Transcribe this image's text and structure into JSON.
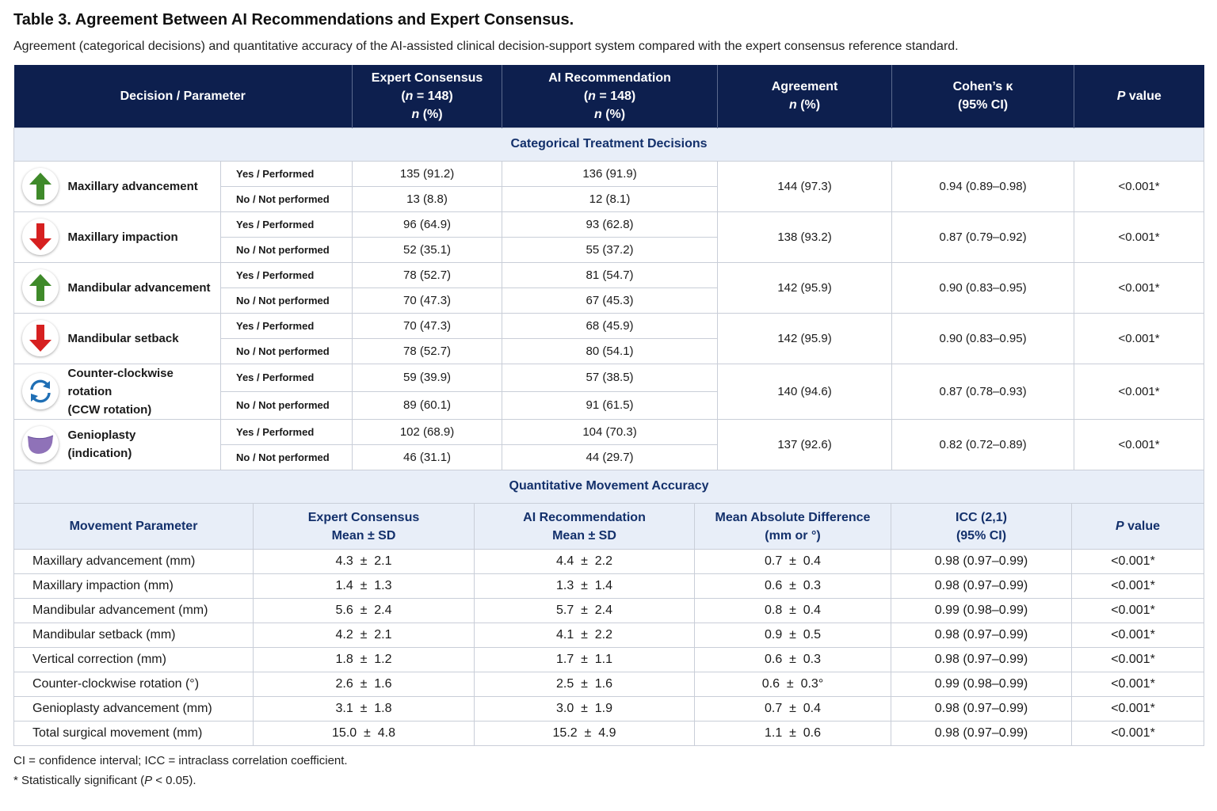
{
  "title": "Table 3. Agreement Between AI Recommendations and Expert Consensus.",
  "subtitle": "Agreement (categorical decisions) and quantitative accuracy of the AI-assisted clinical decision-support system compared with the expert consensus reference standard.",
  "header": {
    "decision": "Decision / Parameter",
    "expert_l1": "Expert Consensus",
    "expert_l2_pre": "(",
    "expert_l2_n": "n",
    "expert_l2_post": " = 148)",
    "expert_l3_n": "n",
    "expert_l3_post": " (%)",
    "ai_l1": "AI Recommendation",
    "ai_l2_pre": "(",
    "ai_l2_n": "n",
    "ai_l2_post": " = 148)",
    "ai_l3_n": "n",
    "ai_l3_post": " (%)",
    "agreement_l1": "Agreement",
    "agreement_l2_n": "n",
    "agreement_l2_post": " (%)",
    "kappa_l1": "Cohen’s κ",
    "kappa_l2": "(95% CI)",
    "p_italic": "P",
    "p_rest": " value"
  },
  "categorical": {
    "section_title": "Categorical Treatment Decisions",
    "yes_label": "Yes / Performed",
    "no_label": "No / Not performed",
    "rows": [
      {
        "name_l1": "Maxillary advancement",
        "name_l2": "",
        "icon": "arrow-up-green-icon",
        "yes_expert": "135 (91.2)",
        "yes_ai": "136 (91.9)",
        "no_expert": "13 (8.8)",
        "no_ai": "12 (8.1)",
        "agreement": "144 (97.3)",
        "kappa": "0.94 (0.89–0.98)",
        "p": "<0.001*"
      },
      {
        "name_l1": "Maxillary impaction",
        "name_l2": "",
        "icon": "arrow-down-red-icon",
        "yes_expert": "96 (64.9)",
        "yes_ai": "93 (62.8)",
        "no_expert": "52 (35.1)",
        "no_ai": "55 (37.2)",
        "agreement": "138 (93.2)",
        "kappa": "0.87 (0.79–0.92)",
        "p": "<0.001*"
      },
      {
        "name_l1": "Mandibular advancement",
        "name_l2": "",
        "icon": "arrow-up-green-icon",
        "yes_expert": "78 (52.7)",
        "yes_ai": "81 (54.7)",
        "no_expert": "70 (47.3)",
        "no_ai": "67 (45.3)",
        "agreement": "142 (95.9)",
        "kappa": "0.90 (0.83–0.95)",
        "p": "<0.001*"
      },
      {
        "name_l1": "Mandibular setback",
        "name_l2": "",
        "icon": "arrow-down-red-icon",
        "yes_expert": "70 (47.3)",
        "yes_ai": "68 (45.9)",
        "no_expert": "78 (52.7)",
        "no_ai": "80 (54.1)",
        "agreement": "142 (95.9)",
        "kappa": "0.90 (0.83–0.95)",
        "p": "<0.001*"
      },
      {
        "name_l1": "Counter-clockwise rotation",
        "name_l2": "(CCW rotation)",
        "icon": "rotation-cycle-icon",
        "yes_expert": "59 (39.9)",
        "yes_ai": "57 (38.5)",
        "no_expert": "89 (60.1)",
        "no_ai": "91 (61.5)",
        "agreement": "140 (94.6)",
        "kappa": "0.87 (0.78–0.93)",
        "p": "<0.001*"
      },
      {
        "name_l1": "Genioplasty",
        "name_l2": "(indication)",
        "icon": "chin-shape-icon",
        "yes_expert": "102 (68.9)",
        "yes_ai": "104 (70.3)",
        "no_expert": "46 (31.1)",
        "no_ai": "44 (29.7)",
        "agreement": "137 (92.6)",
        "kappa": "0.82 (0.72–0.89)",
        "p": "<0.001*"
      }
    ]
  },
  "quantitative": {
    "section_title": "Quantitative Movement Accuracy",
    "header": {
      "param": "Movement Parameter",
      "expert_l1": "Expert Consensus",
      "expert_l2": "Mean ± SD",
      "ai_l1": "AI Recommendation",
      "ai_l2": "Mean ± SD",
      "mad_l1": "Mean Absolute Difference",
      "mad_l2": "(mm or °)",
      "icc_l1": "ICC (2,1)",
      "icc_l2": "(95% CI)",
      "p_italic": "P",
      "p_rest": " value"
    },
    "rows": [
      {
        "label": "Maxillary advancement (mm)",
        "expert": "4.3  ±  2.1",
        "ai": "4.4  ±  2.2",
        "mad": "0.7  ±  0.4",
        "icc": "0.98 (0.97–0.99)",
        "p": "<0.001*"
      },
      {
        "label": "Maxillary impaction (mm)",
        "expert": "1.4  ±  1.3",
        "ai": "1.3  ±  1.4",
        "mad": "0.6  ±  0.3",
        "icc": "0.98 (0.97–0.99)",
        "p": "<0.001*"
      },
      {
        "label": "Mandibular advancement (mm)",
        "expert": "5.6  ±  2.4",
        "ai": "5.7  ±  2.4",
        "mad": "0.8  ±  0.4",
        "icc": "0.99 (0.98–0.99)",
        "p": "<0.001*"
      },
      {
        "label": "Mandibular setback (mm)",
        "expert": "4.2  ±  2.1",
        "ai": "4.1  ±  2.2",
        "mad": "0.9  ±  0.5",
        "icc": "0.98 (0.97–0.99)",
        "p": "<0.001*"
      },
      {
        "label": "Vertical correction (mm)",
        "expert": "1.8  ±  1.2",
        "ai": "1.7  ±  1.1",
        "mad": "0.6  ±  0.3",
        "icc": "0.98 (0.97–0.99)",
        "p": "<0.001*"
      },
      {
        "label": "Counter-clockwise rotation (°)",
        "expert": "2.6  ±  1.6",
        "ai": "2.5  ±  1.6",
        "mad": "0.6  ±  0.3°",
        "icc": "0.99 (0.98–0.99)",
        "p": "<0.001*"
      },
      {
        "label": "Genioplasty advancement (mm)",
        "expert": "3.1  ±  1.8",
        "ai": "3.0  ±  1.9",
        "mad": "0.7  ±  0.4",
        "icc": "0.98 (0.97–0.99)",
        "p": "<0.001*"
      },
      {
        "label": "Total surgical movement (mm)",
        "expert": "15.0  ±  4.8",
        "ai": "15.2  ±  4.9",
        "mad": "1.1  ±  0.6",
        "icc": "0.98 (0.97–0.99)",
        "p": "<0.001*"
      }
    ]
  },
  "footnotes": {
    "line1": "CI = confidence interval; ICC = intraclass correlation coefficient.",
    "line2_pre": "* Statistically significant (",
    "line2_p": "P",
    "line2_post": " < 0.05)."
  },
  "colors": {
    "header_bg": "#0d1f4e",
    "section_bg": "#e8eef8",
    "section_text": "#13306b",
    "arrow_up": "#3f8a2a",
    "arrow_down": "#d62020",
    "rotation": "#1f6fb5",
    "chin": "#8f72b8"
  }
}
